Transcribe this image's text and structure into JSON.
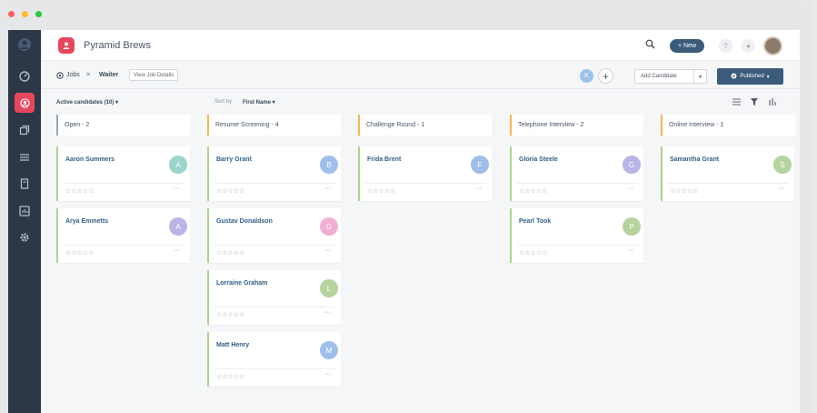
{
  "window": {
    "controls": [
      "#fd5f57",
      "#fdbb2e",
      "#29c940"
    ]
  },
  "sidebar": {
    "items": [
      {
        "icon": "logo-icon"
      },
      {
        "icon": "dashboard-icon"
      },
      {
        "icon": "candidates-icon",
        "active": true
      },
      {
        "icon": "copy-icon"
      },
      {
        "icon": "list-icon"
      },
      {
        "icon": "document-icon"
      },
      {
        "icon": "analytics-icon"
      },
      {
        "icon": "settings-icon"
      }
    ]
  },
  "topbar": {
    "app_name": "Pyramid Brews",
    "new_label": "+ New",
    "help_label": "?",
    "bell_label": "●"
  },
  "subbar": {
    "home_label": "Jobs",
    "separator": ">",
    "current_label": "Waiter",
    "view_job_details": "View Job Details",
    "member_initial": "K",
    "plus_label": "+",
    "add_candidate": "Add Candidate",
    "add_caret": "▾",
    "published": "Published",
    "published_caret": "▾"
  },
  "filterbar": {
    "active_candidates": "Active candidates (10) ▾",
    "sort_label": "Sort by",
    "sort_value": "First Name ▾"
  },
  "colors": {
    "accent": "#e6475e",
    "navy": "#3b5b7a",
    "card_border": "#a9d58a"
  },
  "columns": [
    {
      "title": "Open - 2",
      "border": "#9aa5b1"
    },
    {
      "title": "Resume Screening - 4",
      "border": "#f2b84b"
    },
    {
      "title": "Challenge Round - 1",
      "border": "#f2b84b"
    },
    {
      "title": "Telephone Interview - 2",
      "border": "#f2b84b"
    },
    {
      "title": "Online Interview - 1",
      "border": "#f2b84b"
    }
  ],
  "cards": [
    [
      {
        "name": "Aaron Summers",
        "initial": "A",
        "color": "#9cd4cc"
      },
      {
        "name": "Arya Emmetts",
        "initial": "A",
        "color": "#b8b4e6"
      }
    ],
    [
      {
        "name": "Barry Grant",
        "initial": "B",
        "color": "#9fbfea"
      },
      {
        "name": "Gustav Donaldson",
        "initial": "G",
        "color": "#f0aed3"
      },
      {
        "name": "Lorraine Graham",
        "initial": "L",
        "color": "#b6d39d"
      },
      {
        "name": "Matt Henry",
        "initial": "M",
        "color": "#9fbfea"
      }
    ],
    [
      {
        "name": "Frida Brent",
        "initial": "F",
        "color": "#9fbfea"
      }
    ],
    [
      {
        "name": "Gloria Steele",
        "initial": "G",
        "color": "#b8b4e6"
      },
      {
        "name": "Pearl Took",
        "initial": "P",
        "color": "#b6d39d"
      }
    ],
    [
      {
        "name": "Samantha Grant",
        "initial": "S",
        "color": "#b6d39d"
      }
    ]
  ],
  "card_common": {
    "stars": "☆☆☆☆☆",
    "menu": "···"
  }
}
